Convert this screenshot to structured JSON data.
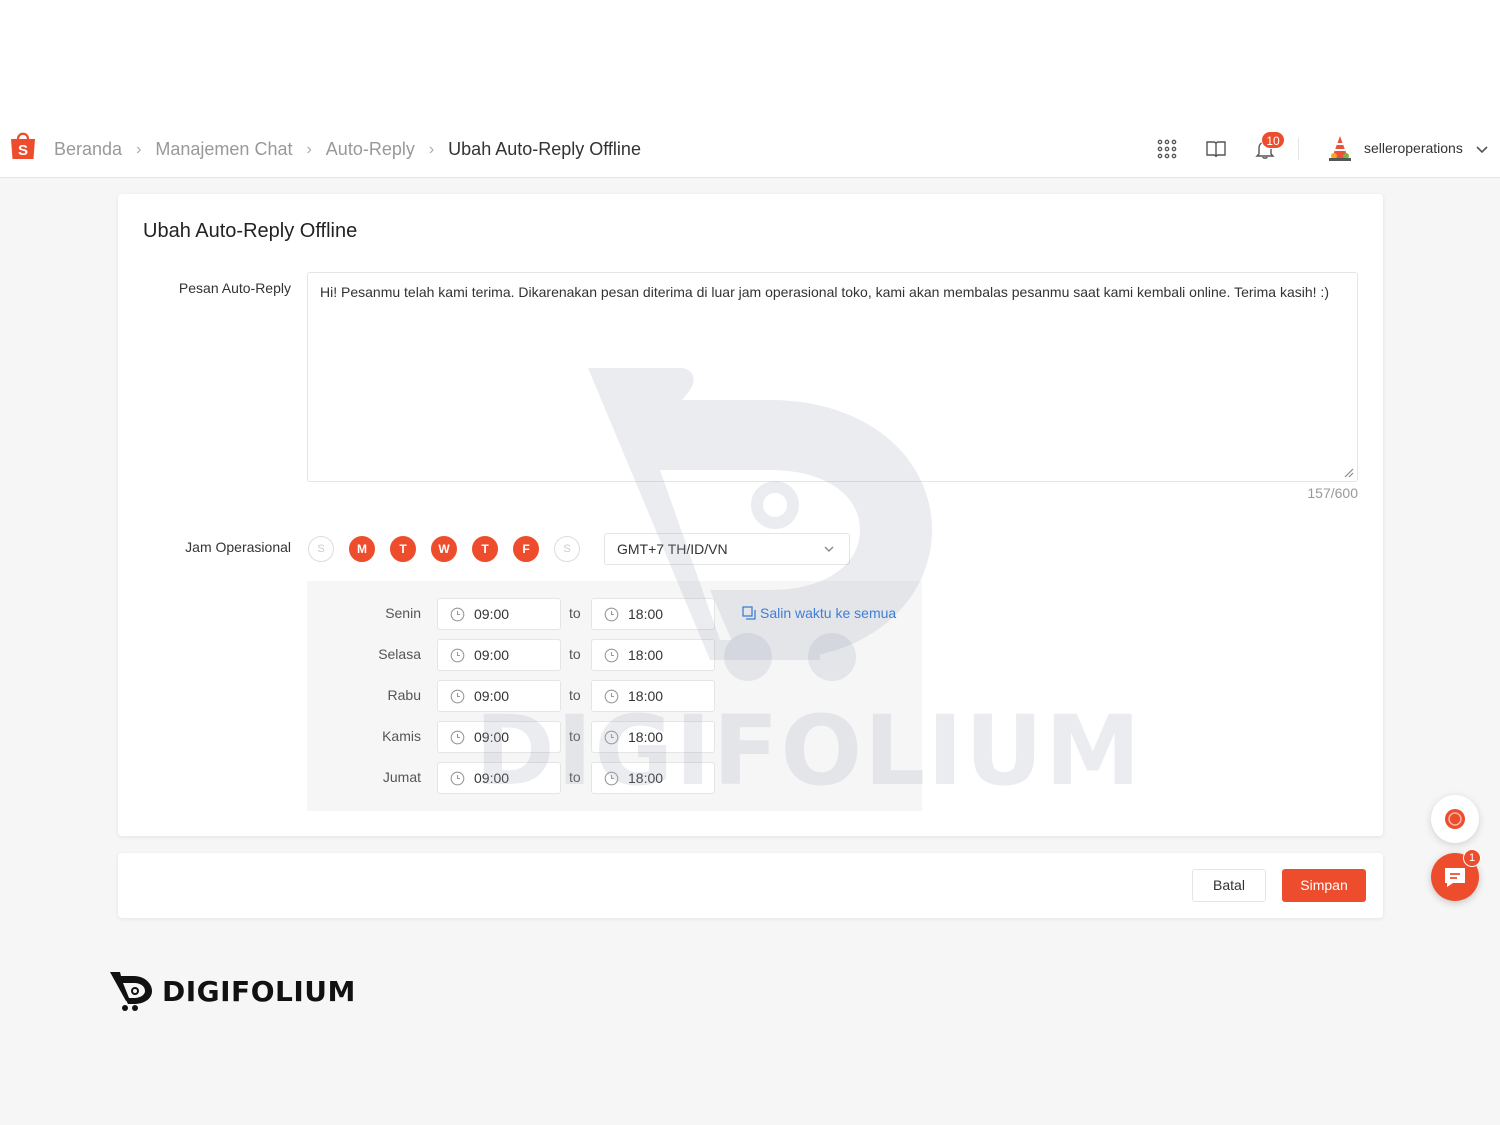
{
  "breadcrumb": {
    "items": [
      "Beranda",
      "Manajemen Chat",
      "Auto-Reply"
    ],
    "current": "Ubah Auto-Reply Offline"
  },
  "header": {
    "notification_count": "10",
    "username": "selleroperations",
    "brand_color": "#ee4d2d"
  },
  "page": {
    "title": "Ubah Auto-Reply Offline",
    "message_label": "Pesan Auto-Reply",
    "message_value": "Hi! Pesanmu telah kami terima. Dikarenakan pesan diterima di luar jam operasional toko, kami akan membalas pesanmu saat kami kembali online. Terima kasih! :)",
    "counter": "157/600",
    "hours_label": "Jam Operasional",
    "days": [
      {
        "letter": "S",
        "active": false
      },
      {
        "letter": "M",
        "active": true
      },
      {
        "letter": "T",
        "active": true
      },
      {
        "letter": "W",
        "active": true
      },
      {
        "letter": "T",
        "active": true
      },
      {
        "letter": "F",
        "active": true
      },
      {
        "letter": "S",
        "active": false
      }
    ],
    "timezone": "GMT+7 TH/ID/VN",
    "to_label": "to",
    "copy_link": "Salin waktu ke semua",
    "schedule": [
      {
        "day": "Senin",
        "start": "09:00",
        "end": "18:00"
      },
      {
        "day": "Selasa",
        "start": "09:00",
        "end": "18:00"
      },
      {
        "day": "Rabu",
        "start": "09:00",
        "end": "18:00"
      },
      {
        "day": "Kamis",
        "start": "09:00",
        "end": "18:00"
      },
      {
        "day": "Jumat",
        "start": "09:00",
        "end": "18:00"
      }
    ]
  },
  "footer": {
    "cancel_label": "Batal",
    "save_label": "Simpan"
  },
  "chat": {
    "badge": "1"
  },
  "watermark": {
    "text": "DIGIFOLIUM"
  },
  "brand": {
    "name": "DIGIFOLIUM"
  }
}
